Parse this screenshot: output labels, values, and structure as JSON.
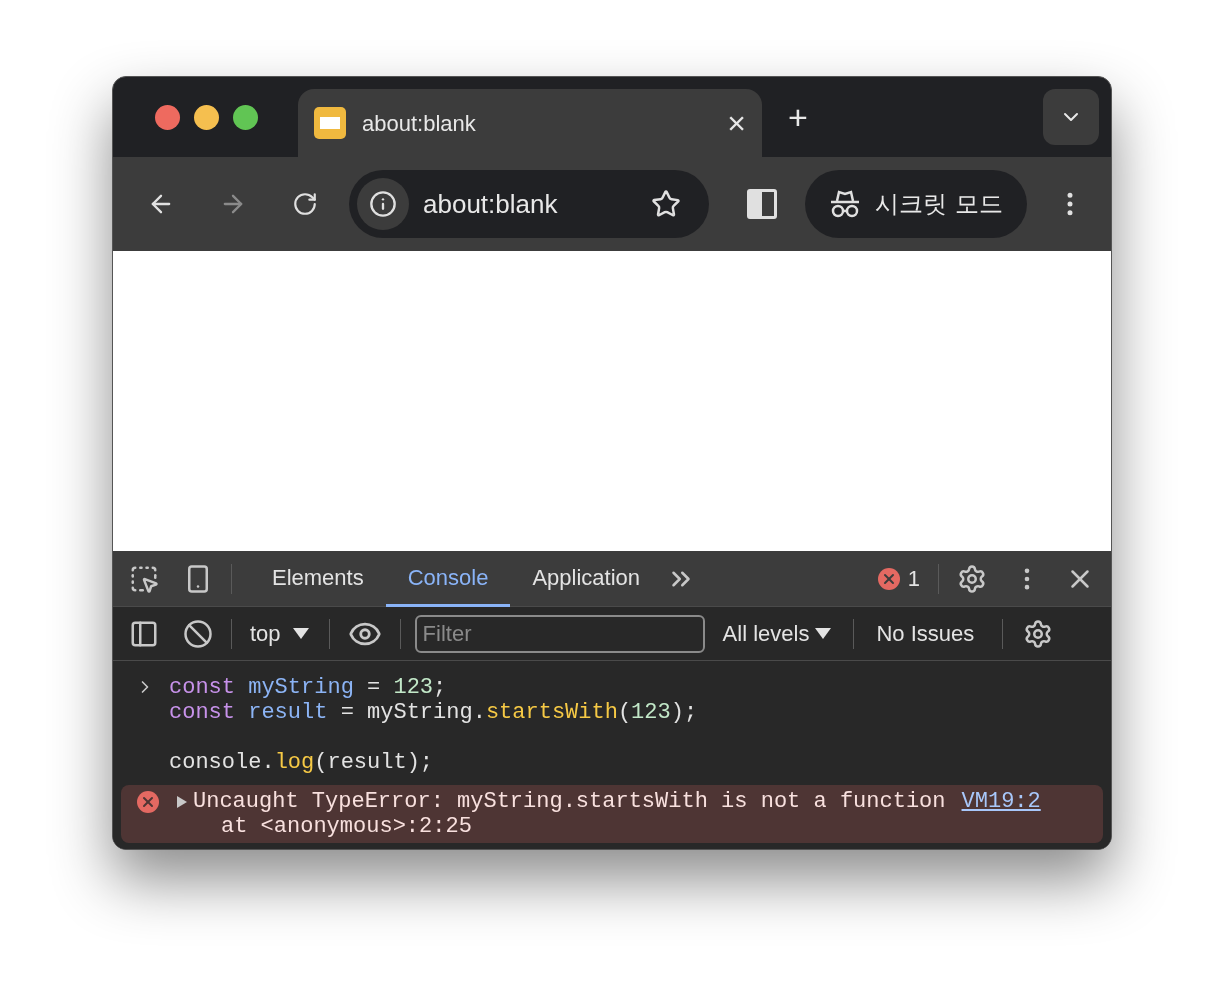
{
  "browser": {
    "tab": {
      "title": "about:blank",
      "close": "×"
    },
    "new_tab": "+",
    "address": "about:blank",
    "incognito_label": "시크릿 모드"
  },
  "devtools": {
    "tabs": [
      {
        "label": "Elements",
        "selected": false
      },
      {
        "label": "Console",
        "selected": true
      },
      {
        "label": "Application",
        "selected": false
      }
    ],
    "error_count": "1",
    "context": "top",
    "filter": {
      "placeholder": "Filter"
    },
    "levels": "All levels",
    "issues": "No Issues"
  },
  "console": {
    "input_blocks": [
      {
        "lines": [
          [
            {
              "kind": "keyword",
              "text": "const "
            },
            {
              "kind": "variable",
              "text": "myString"
            },
            {
              "kind": "plain",
              "text": " = "
            },
            {
              "kind": "number",
              "text": "123"
            },
            {
              "kind": "plain",
              "text": ";"
            }
          ],
          [
            {
              "kind": "keyword",
              "text": "const "
            },
            {
              "kind": "variable",
              "text": "result"
            },
            {
              "kind": "plain",
              "text": " = myString."
            },
            {
              "kind": "method",
              "text": "startsWith"
            },
            {
              "kind": "plain",
              "text": "("
            },
            {
              "kind": "number",
              "text": "123"
            },
            {
              "kind": "plain",
              "text": ");"
            }
          ]
        ]
      },
      {
        "lines": [
          [
            {
              "kind": "plain",
              "text": "console."
            },
            {
              "kind": "method",
              "text": "log"
            },
            {
              "kind": "plain",
              "text": "(result);"
            }
          ]
        ]
      }
    ],
    "error": {
      "message": "Uncaught TypeError: myString.startsWith is not a function",
      "source": "VM19:2",
      "stack": "at <anonymous>:2:25",
      "expanded": false
    }
  }
}
